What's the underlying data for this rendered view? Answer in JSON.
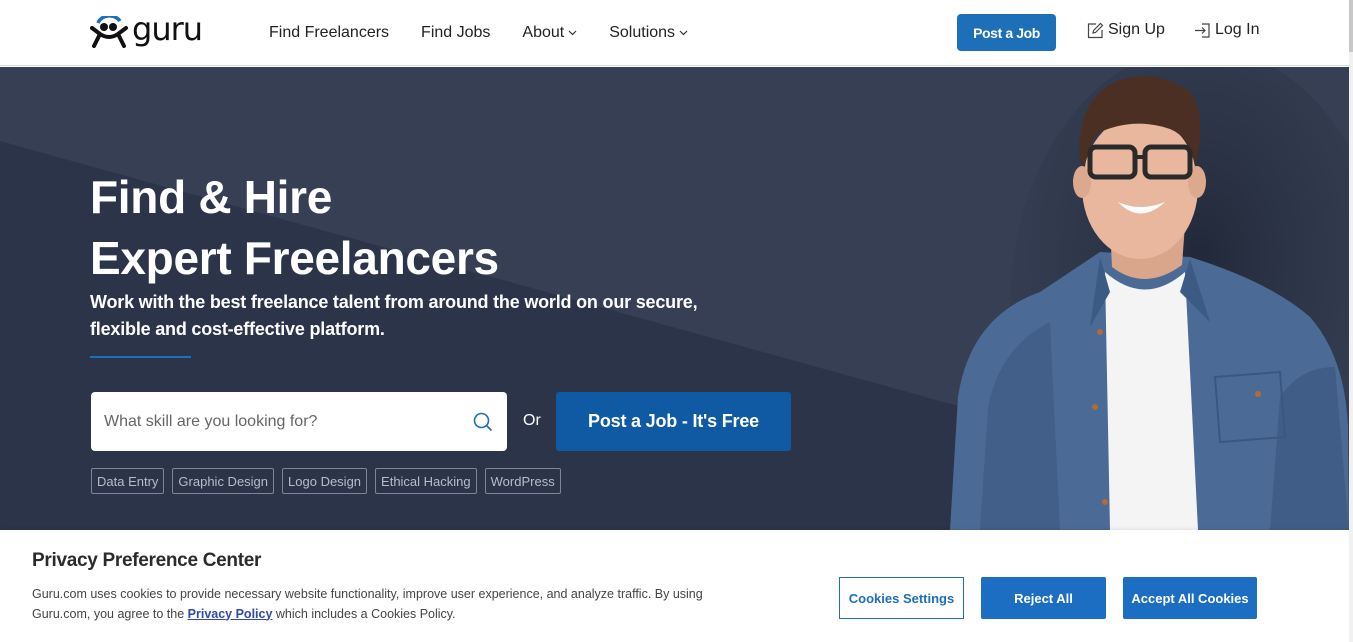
{
  "header": {
    "logo_text": "guru",
    "nav": [
      {
        "label": "Find Freelancers",
        "has_dropdown": false
      },
      {
        "label": "Find Jobs",
        "has_dropdown": false
      },
      {
        "label": "About",
        "has_dropdown": true
      },
      {
        "label": "Solutions",
        "has_dropdown": true
      }
    ],
    "post_job_label": "Post a Job",
    "signup_label": "Sign Up",
    "login_label": "Log In",
    "chevron_glyph": "⌵",
    "brand_color": "#1d6fb8"
  },
  "hero": {
    "title_line1": "Find & Hire",
    "title_line2": "Expert Freelancers",
    "subtitle_line1": "Work with the best freelance talent from around the world on our secure,",
    "subtitle_line2": "flexible and cost-effective platform.",
    "search_placeholder": "What skill are you looking for?",
    "search_value": "",
    "or_label": "Or",
    "post_job_free_label": "Post a Job - It's Free",
    "tags": [
      "Data Entry",
      "Graphic Design",
      "Logo Design",
      "Ethical Hacking",
      "WordPress"
    ],
    "image_description": "Smiling man with glasses wearing denim shirt over white t-shirt"
  },
  "cookie_banner": {
    "title": "Privacy Preference Center",
    "text_before_link": "Guru.com uses cookies to provide necessary website functionality, improve user experience, and analyze traffic. By using Guru.com, you agree to the ",
    "link_label": "Privacy Policy",
    "text_after_link": " which includes a Cookies Policy.",
    "settings_label": "Cookies Settings",
    "reject_label": "Reject All",
    "accept_label": "Accept All Cookies"
  }
}
